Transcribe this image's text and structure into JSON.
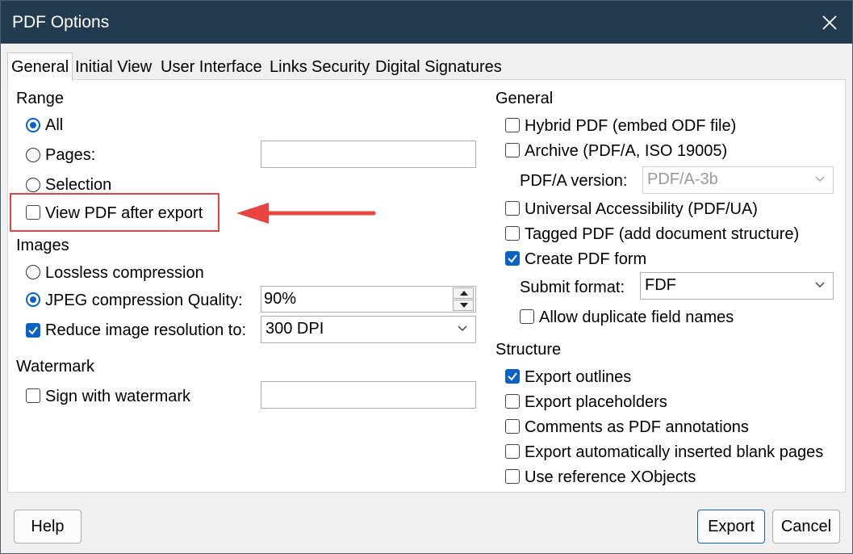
{
  "window": {
    "title": "PDF Options"
  },
  "tabs": [
    "General",
    "Initial View",
    "User Interface",
    "Links",
    "Security",
    "Digital Signatures"
  ],
  "range": {
    "heading": "Range",
    "all": "All",
    "pages": "Pages:",
    "pages_value": "",
    "selection": "Selection",
    "view_pdf": "View PDF after export"
  },
  "images": {
    "heading": "Images",
    "lossless": "Lossless compression",
    "jpeg": "JPEG compression Quality:",
    "jpeg_value": "90%",
    "reduce": "Reduce image resolution to:",
    "reduce_value": "300 DPI"
  },
  "watermark": {
    "heading": "Watermark",
    "sign": "Sign with watermark",
    "value": ""
  },
  "general": {
    "heading": "General",
    "hybrid": "Hybrid PDF (embed ODF file)",
    "archive": "Archive (PDF/A, ISO 19005)",
    "pdfa_label": "PDF/A version:",
    "pdfa_value": "PDF/A-3b",
    "ua": "Universal Accessibility (PDF/UA)",
    "tagged": "Tagged PDF (add document structure)",
    "form": "Create PDF form",
    "submit_label": "Submit format:",
    "submit_value": "FDF",
    "duplicate": "Allow duplicate field names"
  },
  "structure": {
    "heading": "Structure",
    "outlines": "Export outlines",
    "placeholders": "Export placeholders",
    "comments": "Comments as PDF annotations",
    "blank": "Export automatically inserted blank pages",
    "xobjects": "Use reference XObjects"
  },
  "buttons": {
    "help": "Help",
    "export": "Export",
    "cancel": "Cancel"
  },
  "colors": {
    "titlebar": "#233b50",
    "accent": "#0a62c4",
    "annotation": "#e8433f"
  }
}
